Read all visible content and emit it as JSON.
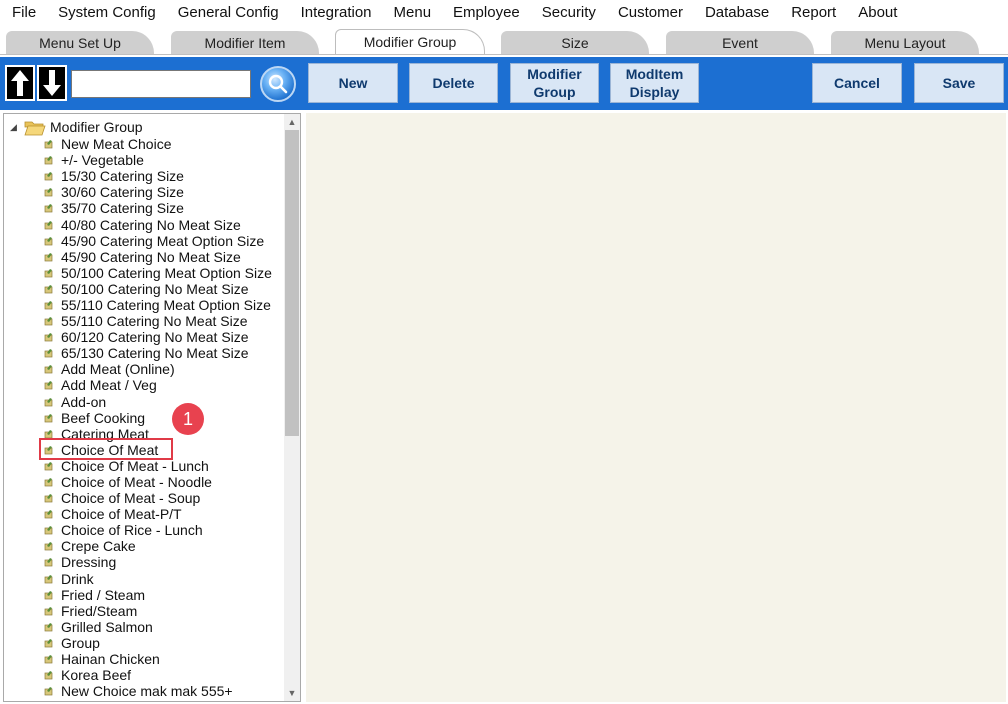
{
  "menubar": [
    "File",
    "System Config",
    "General Config",
    "Integration",
    "Menu",
    "Employee",
    "Security",
    "Customer",
    "Database",
    "Report",
    "About"
  ],
  "tabs": [
    {
      "label": "Menu Set Up",
      "active": false
    },
    {
      "label": "Modifier Item",
      "active": false
    },
    {
      "label": "Modifier Group",
      "active": true
    },
    {
      "label": "Size",
      "active": false
    },
    {
      "label": "Event",
      "active": false
    },
    {
      "label": "Menu Layout",
      "active": false
    }
  ],
  "search": {
    "value": "",
    "placeholder": ""
  },
  "toolbar": {
    "new_label": "New",
    "delete_label": "Delete",
    "modifier_group_line1": "Modifier",
    "modifier_group_line2": "Group",
    "moditem_line1": "ModItem",
    "moditem_line2": "Display",
    "cancel_label": "Cancel",
    "save_label": "Save"
  },
  "tree": {
    "root_label": "Modifier Group",
    "items": [
      " New Meat Choice",
      "+/- Vegetable",
      "15/30 Catering Size",
      "30/60 Catering Size",
      "35/70 Catering Size",
      "40/80 Catering No Meat Size",
      "45/90 Catering Meat Option Size",
      "45/90 Catering No Meat Size",
      "50/100 Catering Meat Option Size",
      "50/100 Catering No Meat Size",
      "55/110 Catering Meat Option Size",
      "55/110 Catering No Meat Size",
      "60/120 Catering No Meat Size",
      "65/130 Catering No Meat Size",
      "Add Meat (Online)",
      "Add Meat / Veg",
      "Add-on",
      "Beef Cooking",
      "Catering Meat",
      "Choice Of Meat",
      "Choice Of Meat - Lunch",
      "Choice of Meat - Noodle",
      "Choice of Meat - Soup",
      "Choice of Meat-P/T",
      "Choice of Rice - Lunch",
      "Crepe Cake",
      "Dressing",
      "Drink",
      "Fried / Steam",
      "Fried/Steam",
      "Grilled Salmon",
      "Group",
      "Hainan Chicken",
      "Korea Beef",
      "New Choice mak mak 555+"
    ],
    "highlighted": "Choice Of Meat"
  },
  "annotation": {
    "badge": "1"
  },
  "colors": {
    "accent": "#1c6fd2",
    "highlight": "#e03a47",
    "content_bg": "#f5f3e9",
    "button_bg": "#d9e6f5"
  }
}
